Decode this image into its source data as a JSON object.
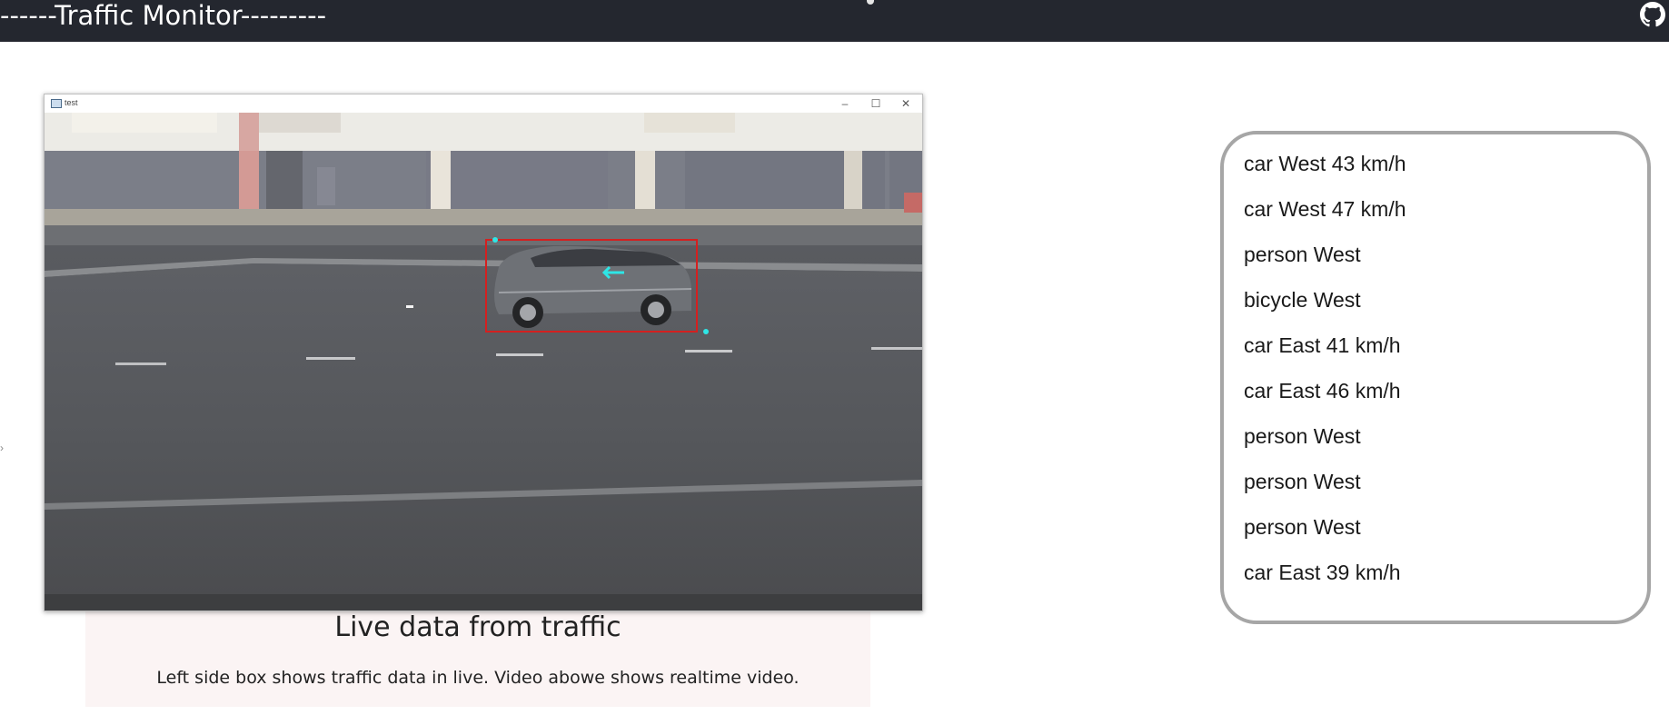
{
  "header": {
    "brand": "------Traffic Monitor---------",
    "github_icon": "github-icon",
    "background": "#24272f"
  },
  "video_window": {
    "title": "test",
    "controls": [
      "–",
      "☐",
      "✕"
    ]
  },
  "caption": {
    "title": "Live data from traffic",
    "text": "Left side box shows traffic data in live. Video abowe shows realtime video."
  },
  "detections": [
    "car West 43 km/h",
    "car West 47 km/h",
    "person West",
    "bicycle West",
    "car East 41 km/h",
    "car East 46 km/h",
    "person West",
    "person West",
    "person West",
    "car East 39 km/h"
  ],
  "colors": {
    "bounding_box": "#d42020",
    "tracking_marker": "#2ee6e6",
    "list_border": "#a6a6a6",
    "caption_bg": "#fbf4f4"
  }
}
